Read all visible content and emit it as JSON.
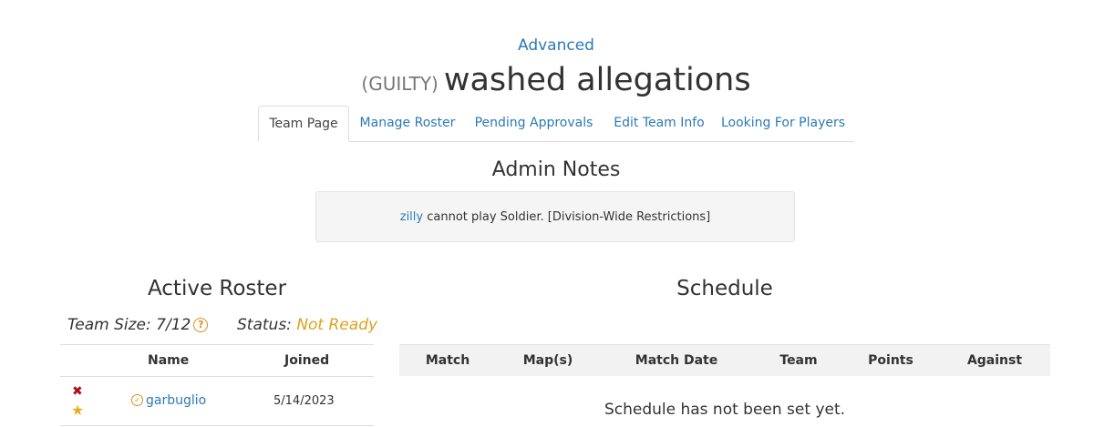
{
  "header": {
    "division_link": "Advanced",
    "team_tag": "(GUILTY)",
    "team_name": "washed allegations"
  },
  "tabs": [
    {
      "label": "Team Page",
      "active": true
    },
    {
      "label": "Manage Roster",
      "active": false
    },
    {
      "label": "Pending Approvals",
      "active": false
    },
    {
      "label": "Edit Team Info",
      "active": false
    },
    {
      "label": "Looking For Players",
      "active": false
    }
  ],
  "admin_notes": {
    "title": "Admin Notes",
    "player_link": "zilly",
    "text": " cannot play Soldier. [Division-Wide Restrictions]"
  },
  "roster": {
    "title": "Active Roster",
    "team_size_label": "Team Size:",
    "team_size_value": "7/12",
    "status_label": "Status:",
    "status_value": "Not Ready",
    "columns": [
      "Name",
      "Joined"
    ],
    "rows": [
      {
        "name": "garbuglio",
        "joined": "5/14/2023"
      }
    ]
  },
  "schedule": {
    "title": "Schedule",
    "columns": [
      "Match",
      "Map(s)",
      "Match Date",
      "Team",
      "Points",
      "Against"
    ],
    "empty_message": "Schedule has not been set yet."
  },
  "colors": {
    "link": "#2a7ab8",
    "status_not_ready": "#e0a020",
    "remove_icon": "#a8121a",
    "captain_star": "#e8b020"
  },
  "icons": {
    "help": "question-circle-icon",
    "remove": "x-mark-icon",
    "captain": "star-icon",
    "verified": "check-circle-icon"
  }
}
